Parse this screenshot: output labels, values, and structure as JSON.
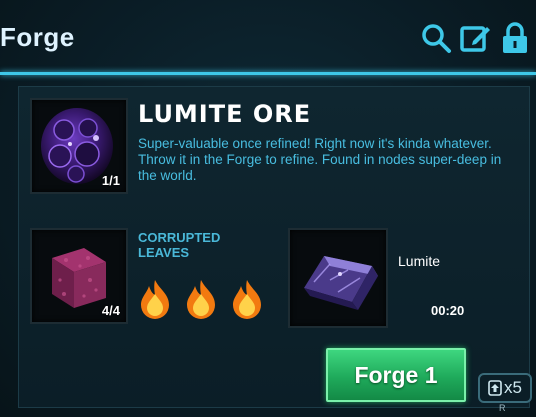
{
  "header": {
    "title": "Forge"
  },
  "icons": {
    "search": "search-icon",
    "edit": "edit-icon",
    "lock": "lock-icon"
  },
  "item": {
    "name": "LUMITE ORE",
    "description": "Super-valuable once refined! Right now it's kinda whatever. Throw it in the Forge to refine. Found in nodes super-deep in the world.",
    "quantity": "1/1"
  },
  "recipe": {
    "input_label": "CORRUPTED LEAVES",
    "input_quantity": "4/4",
    "output_label": "Lumite",
    "timer": "00:20",
    "flames": 3
  },
  "actions": {
    "forge_label": "Forge 1",
    "multiplier": "x5",
    "key_hint": "R"
  },
  "colors": {
    "accent": "#3ec8e8",
    "button": "#2ac06a",
    "desc_text": "#48bde0"
  }
}
